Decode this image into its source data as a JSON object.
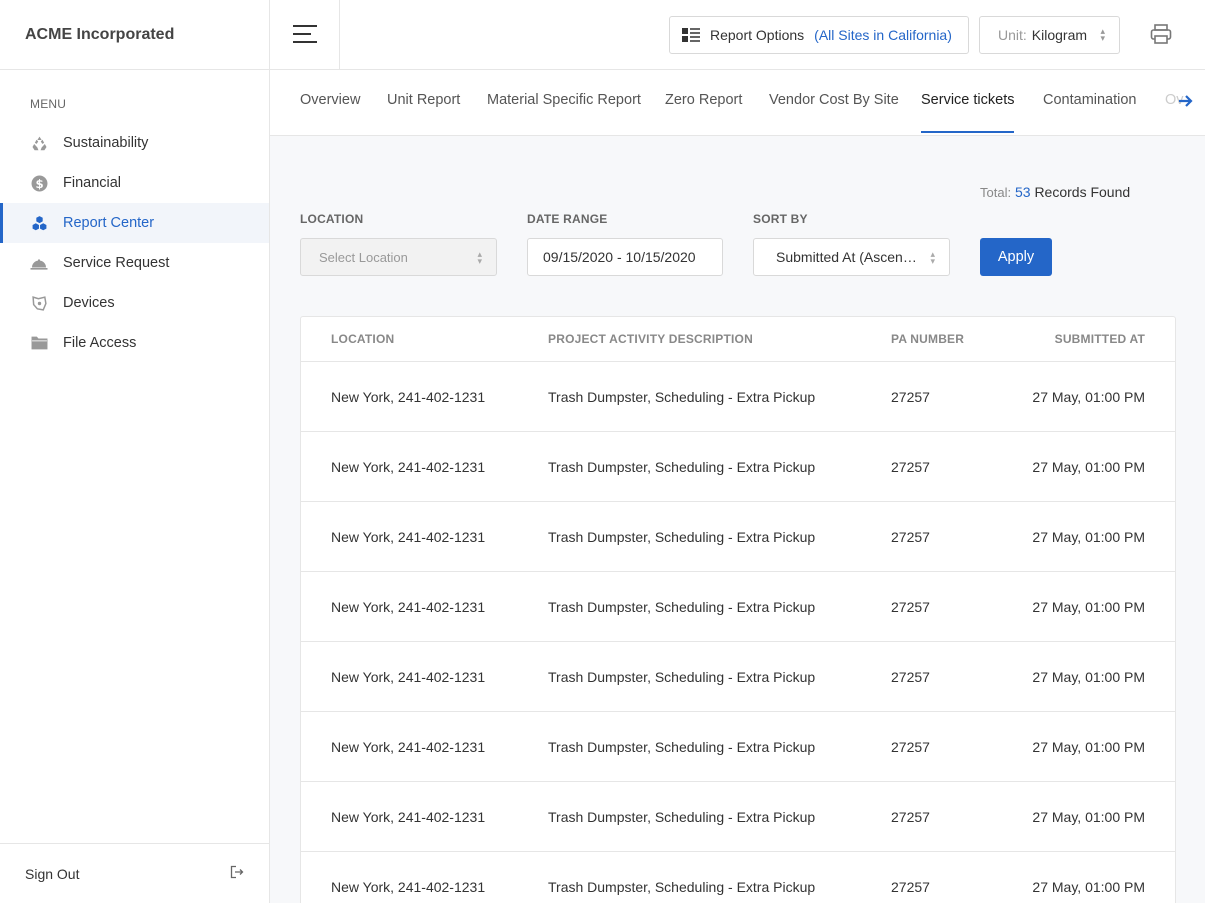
{
  "app": {
    "brand": "ACME Incorporated"
  },
  "sidebar": {
    "menu_label": "MENU",
    "items": [
      {
        "label": "Sustainability",
        "icon": "recycle-icon"
      },
      {
        "label": "Financial",
        "icon": "dollar-icon"
      },
      {
        "label": "Report Center",
        "icon": "cubes-icon",
        "active": true
      },
      {
        "label": "Service Request",
        "icon": "service-bell-icon"
      },
      {
        "label": "Devices",
        "icon": "device-icon"
      },
      {
        "label": "File Access",
        "icon": "folder-icon"
      }
    ],
    "sign_out": "Sign Out"
  },
  "topbar": {
    "report_options_label": "Report Options",
    "report_options_scope": "(All Sites in California)",
    "unit_label": "Unit:",
    "unit_value": "Kilogram"
  },
  "tabs": [
    {
      "label": "Overview"
    },
    {
      "label": "Unit Report"
    },
    {
      "label": "Material Specific Report"
    },
    {
      "label": "Zero Report"
    },
    {
      "label": "Vendor Cost By Site"
    },
    {
      "label": "Service tickets",
      "active": true
    },
    {
      "label": "Contamination"
    },
    {
      "label": "Ov"
    }
  ],
  "results": {
    "total_label": "Total:",
    "total_count": "53",
    "total_suffix": "Records Found"
  },
  "filters": {
    "location": {
      "label": "LOCATION",
      "placeholder": "Select Location"
    },
    "date_range": {
      "label": "DATE RANGE",
      "value": "09/15/2020 - 10/15/2020"
    },
    "sort_by": {
      "label": "SORT BY",
      "value": "Submitted At (Ascen…"
    },
    "apply": "Apply"
  },
  "table": {
    "headers": [
      "LOCATION",
      "PROJECT ACTIVITY DESCRIPTION",
      "PA NUMBER",
      "SUBMITTED AT"
    ],
    "rows": [
      [
        "New York, 241-402-1231",
        "Trash Dumpster, Scheduling - Extra Pickup",
        "27257",
        "27 May, 01:00 PM"
      ],
      [
        "New York, 241-402-1231",
        "Trash Dumpster, Scheduling - Extra Pickup",
        "27257",
        "27 May, 01:00 PM"
      ],
      [
        "New York, 241-402-1231",
        "Trash Dumpster, Scheduling - Extra Pickup",
        "27257",
        "27 May, 01:00 PM"
      ],
      [
        "New York, 241-402-1231",
        "Trash Dumpster, Scheduling - Extra Pickup",
        "27257",
        "27 May, 01:00 PM"
      ],
      [
        "New York, 241-402-1231",
        "Trash Dumpster, Scheduling - Extra Pickup",
        "27257",
        "27 May, 01:00 PM"
      ],
      [
        "New York, 241-402-1231",
        "Trash Dumpster, Scheduling - Extra Pickup",
        "27257",
        "27 May, 01:00 PM"
      ],
      [
        "New York, 241-402-1231",
        "Trash Dumpster, Scheduling - Extra Pickup",
        "27257",
        "27 May, 01:00 PM"
      ],
      [
        "New York, 241-402-1231",
        "Trash Dumpster, Scheduling - Extra Pickup",
        "27257",
        "27 May, 01:00 PM"
      ]
    ]
  },
  "colors": {
    "accent": "#2466c8",
    "border": "#e6e6e6",
    "content_bg": "#f7f8fa"
  }
}
